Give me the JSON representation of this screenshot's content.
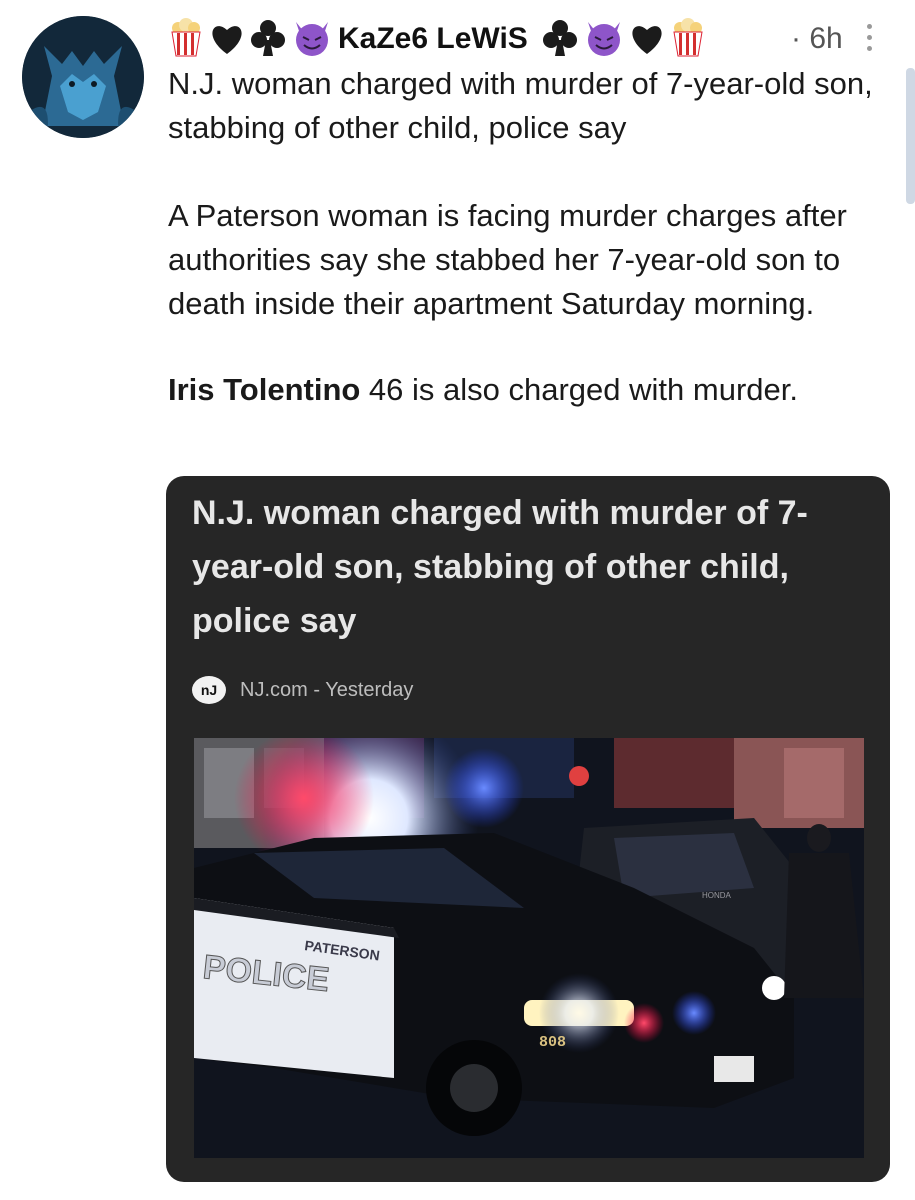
{
  "tweet": {
    "username": "KaZe6 LeWiS",
    "timestamp": "· 6h",
    "title": "N.J. woman charged with murder of 7-year-old son, stabbing of other child, police say",
    "body": "A Paterson woman is facing murder charges after authorities say she stabbed her 7-year-old son to death inside their apartment Saturday morning.",
    "charge_name": "Iris Tolentino",
    "charge_rest": " 46 is also charged with murder."
  },
  "card": {
    "title": "N.J. woman charged with murder of 7-year-old son, stabbing of other child, police say",
    "source_logo": "nJ",
    "source": "NJ.com - Yesterday"
  },
  "image": {
    "car_text_city": "PATERSON",
    "car_text_police": "POLICE",
    "car_number": "808",
    "brand": "HONDA"
  },
  "icons": {
    "avatar": "wolf-avatar",
    "more": "vertical-dots-icon",
    "emoji": [
      "popcorn-icon",
      "heart-icon",
      "club-icon",
      "devil-icon"
    ]
  }
}
